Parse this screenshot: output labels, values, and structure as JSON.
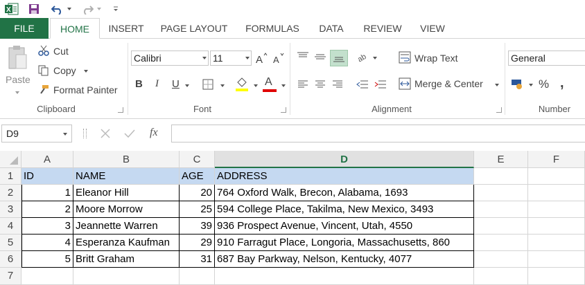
{
  "ribbon_tabs": [
    "FILE",
    "HOME",
    "INSERT",
    "PAGE LAYOUT",
    "FORMULAS",
    "DATA",
    "REVIEW",
    "VIEW"
  ],
  "clipboard": {
    "paste": "Paste",
    "cut": "Cut",
    "copy": "Copy",
    "format_painter": "Format Painter",
    "label": "Clipboard"
  },
  "font": {
    "name": "Calibri",
    "size": "11",
    "label": "Font",
    "bold": "B",
    "italic": "I",
    "underline": "U",
    "font_color_glyph": "A"
  },
  "alignment": {
    "wrap_text": "Wrap Text",
    "merge_center": "Merge & Center",
    "label": "Alignment"
  },
  "number": {
    "format": "General",
    "label": "Number",
    "percent": "%",
    "comma": ","
  },
  "formula_bar": {
    "name_box": "D9",
    "fx": "fx",
    "formula": ""
  },
  "columns": [
    "A",
    "B",
    "C",
    "D",
    "E",
    "F"
  ],
  "rows": [
    "1",
    "2",
    "3",
    "4",
    "5",
    "6",
    "7"
  ],
  "table": {
    "headers": [
      "ID",
      "NAME",
      "AGE",
      "ADDRESS"
    ],
    "records": [
      [
        "1",
        "Eleanor Hill",
        "20",
        "764 Oxford Walk, Brecon, Alabama, 1693"
      ],
      [
        "2",
        "Moore Morrow",
        "25",
        "594 College Place, Takilma, New Mexico, 3493"
      ],
      [
        "3",
        "Jeannette Warren",
        "39",
        "936 Prospect Avenue, Vincent, Utah, 4550"
      ],
      [
        "4",
        "Esperanza Kaufman",
        "29",
        "910 Farragut Place, Longoria, Massachusetts, 860"
      ],
      [
        "5",
        "Britt Graham",
        "31",
        "687 Bay Parkway, Nelson, Kentucky, 4077"
      ]
    ]
  },
  "colors": {
    "excel_green": "#217346",
    "header_fill": "#c5d9f1",
    "font_color_bar": "#e00000"
  }
}
